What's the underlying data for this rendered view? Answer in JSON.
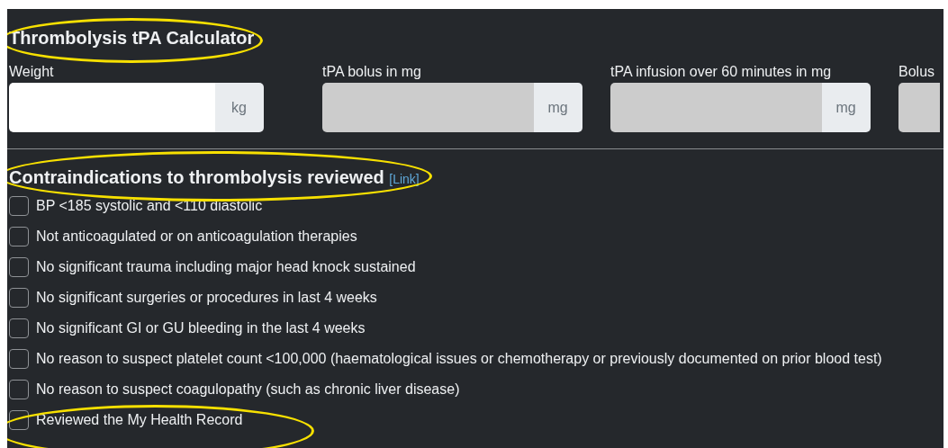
{
  "title": {
    "text": "Thrombolysis tPA Calculator",
    "circled": true
  },
  "fields": [
    {
      "label": "Weight",
      "unit": "kg",
      "readonly": false
    },
    {
      "label": "tPA bolus in mg",
      "unit": "mg",
      "readonly": true
    },
    {
      "label": "tPA infusion over 60 minutes in mg",
      "unit": "mg",
      "readonly": true
    },
    {
      "label": "Bolus",
      "readonly": true
    }
  ],
  "contraindications": {
    "heading": "Contraindications to thrombolysis reviewed",
    "link": "[Link]",
    "circled": true,
    "items": [
      {
        "label": "BP <185 systolic and <110 diastolic",
        "checked": false
      },
      {
        "label": "Not anticoagulated or on anticoagulation therapies",
        "checked": false
      },
      {
        "label": "No significant trauma including major head knock sustained",
        "checked": false
      },
      {
        "label": "No significant surgeries or procedures in last 4 weeks",
        "checked": false
      },
      {
        "label": "No significant GI or GU bleeding in the last 4 weeks",
        "checked": false
      },
      {
        "label": "No reason to suspect platelet count <100,000 (haematological issues or chemotherapy or previously documented on prior blood test)",
        "checked": false
      },
      {
        "label": "No reason to suspect coagulopathy (such as chronic liver disease)",
        "checked": false
      },
      {
        "label": "Reviewed the My Health Record",
        "checked": false,
        "circled": true
      }
    ]
  }
}
